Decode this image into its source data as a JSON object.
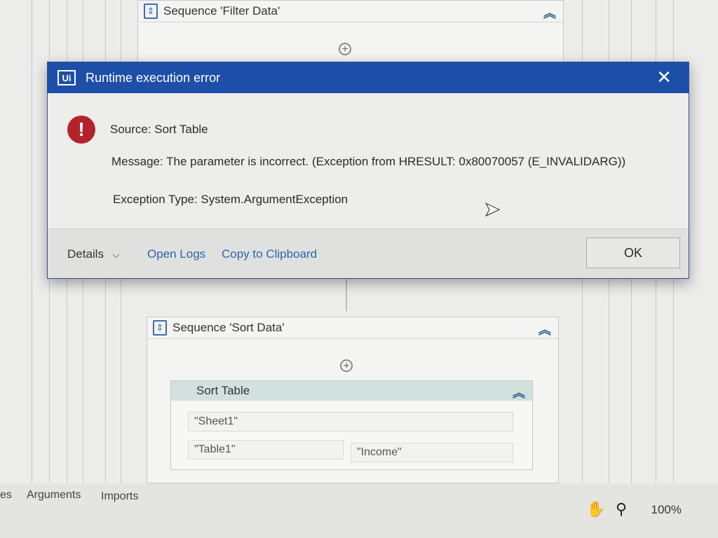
{
  "designer": {
    "filter_sequence": {
      "title": "Sequence 'Filter Data'"
    },
    "sort_sequence": {
      "title": "Sequence 'Sort Data'"
    },
    "sort_activity": {
      "title": "Sort Table",
      "sheet_value": "\"Sheet1\"",
      "table_value": "\"Table1\"",
      "column_value": "\"Income\""
    }
  },
  "dialog": {
    "title": "Runtime execution error",
    "logo_text": "Ui",
    "source": "Source: Sort Table",
    "message": "Message: The parameter is incorrect. (Exception from HRESULT: 0x80070057 (E_INVALIDARG))",
    "exception_type": "Exception Type: System.ArgumentException",
    "details_label": "Details",
    "open_logs_label": "Open Logs",
    "copy_clipboard_label": "Copy to Clipboard",
    "ok_label": "OK",
    "error_icon": "!",
    "close_icon": "✕"
  },
  "bottom_bar": {
    "variables_tab": "es",
    "arguments_tab": "Arguments",
    "imports_tab": "Imports",
    "zoom": "100%"
  },
  "colors": {
    "titlebar": "#1e4fa8",
    "error_red": "#b2232c",
    "link_blue": "#2d65b0"
  }
}
